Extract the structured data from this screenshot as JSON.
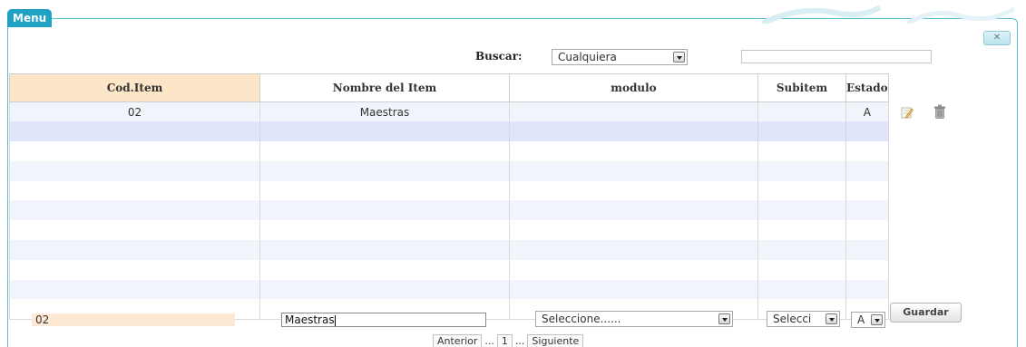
{
  "panel": {
    "title": "Menu",
    "close_label": "✕"
  },
  "search": {
    "label": "Buscar:",
    "selected": "Cualquiera",
    "value": ""
  },
  "grid": {
    "columns": [
      "Cod.Item",
      "Nombre del Item",
      "modulo",
      "Subitem",
      "Estado"
    ],
    "rows": [
      {
        "cod": "02",
        "nombre": "Maestras",
        "modulo": "",
        "subitem": "",
        "estado": "A"
      }
    ]
  },
  "form": {
    "cod_value": "02",
    "name_value": "Maestras",
    "modulo_selected": "Seleccione......",
    "subitem_selected": "Selecci",
    "estado_selected": "A",
    "save_label": "Guardar"
  },
  "pager": {
    "prev_label": "Anterior",
    "ellipsis": "...",
    "page": "1",
    "next_label": "Siguiente"
  },
  "icons": {
    "edit": "edit-icon",
    "delete": "trash-icon",
    "close": "close-icon"
  },
  "colors": {
    "accent": "#1fa2c4",
    "sorted_header": "#fde5c7",
    "alt_row": "#f1f5fb",
    "highlight_row": "#dfe6fb"
  }
}
